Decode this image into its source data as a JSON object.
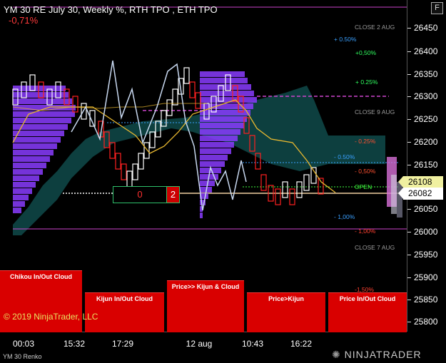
{
  "header": {
    "title": "YM 30 RE July 30, Weekly %, RTH TPO , ETH TPO",
    "change": "-0,71%",
    "f_button": "F"
  },
  "y_axis": {
    "ticks": [
      "26450",
      "26400",
      "26350",
      "26300",
      "26250",
      "26200",
      "26150",
      "26100",
      "26050",
      "26000",
      "25950",
      "25900",
      "25850",
      "25800"
    ],
    "last_price": "26082",
    "price_marker": "26108"
  },
  "x_axis": {
    "ticks": [
      "00:03",
      "15:32",
      "17:29",
      "12 aug",
      "10:43",
      "16:22"
    ]
  },
  "annotations": {
    "close_2_aug": "CLOSE 2 AUG",
    "plus_050_a": "+ 0.50%",
    "plus_050_b": "+0,50%",
    "plus_025": "+ 0.25%",
    "close_9_aug": "CLOSE 9 AUG",
    "minus_025": "- 0.25%",
    "minus_050_a": "- 0.50%",
    "minus_050_b": "- 0,50%",
    "open": "OPEN",
    "minus_100_a": "- 1,00%",
    "minus_100_b": "- 1,00%",
    "close_7_aug": "CLOSE 7 AUG",
    "minus_150": "-1,50%"
  },
  "counter": {
    "left_value": "0",
    "right_value": "2"
  },
  "cloud_indicators": [
    "Chikou In/Out Cloud",
    "Kijun In/Out Cloud",
    "Price>> Kijun & Cloud",
    "Price>Kijun",
    "Price In/Out Cloud"
  ],
  "footer": {
    "instrument": "YM 30 Renko",
    "copyright": "© 2019 NinjaTrader, LLC",
    "logo": "NINJATRADER"
  },
  "colors": {
    "bull": "#ffffff",
    "bear": "#ff2020",
    "cloud": "#0d3f3f",
    "tpo": "#8a3cff",
    "kijun": "#e8b830",
    "chikou": "#c8d8f0",
    "magenta": "#cc44cc"
  },
  "icons": {
    "logo_mark": "ninjatrader-logo-icon"
  }
}
